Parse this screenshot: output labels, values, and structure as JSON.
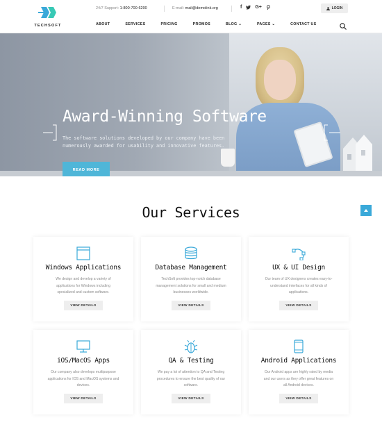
{
  "brand": {
    "name": "TECHSOFT",
    "accent": "#3aa9d9",
    "button_blue": "#4fb6d8"
  },
  "topbar": {
    "support_label": "24/7 Support:",
    "support_phone": "1-800-700-6200",
    "email_label": "E-mail:",
    "email": "mail@demolink.org",
    "socials": [
      "facebook-icon",
      "twitter-icon",
      "google-plus-icon",
      "pinterest-icon"
    ],
    "social_glyphs": [
      "f",
      "❦",
      "G+",
      "℗"
    ],
    "login_label": "LOGIN"
  },
  "nav": {
    "items": [
      {
        "label": "ABOUT"
      },
      {
        "label": "SERVICES"
      },
      {
        "label": "PRICING"
      },
      {
        "label": "PROMOS"
      },
      {
        "label": "BLOG ⌄"
      },
      {
        "label": "PAGES ⌄"
      },
      {
        "label": "CONTACT US"
      }
    ]
  },
  "hero": {
    "title": "Award-Winning Software",
    "subtitle": "The software solutions developed by our company have been numerously awarded for usability and innovative features.",
    "cta_label": "READ MORE"
  },
  "services": {
    "title": "Our Services",
    "button_label": "VIEW DETAILS",
    "items": [
      {
        "title": "Windows Applications",
        "icon": "window-icon",
        "desc": "We design and develop a variety of applications for Windows including specialized and custom software."
      },
      {
        "title": "Database Management",
        "icon": "database-icon",
        "desc": "TechSoft provides top-notch database management solutions for small and medium businesses worldwide."
      },
      {
        "title": "UX & UI Design",
        "icon": "vector-design-icon",
        "desc": "Our team of UX designers creates easy-to-understand interfaces for all kinds of applications."
      },
      {
        "title": "iOS/MacOS Apps",
        "icon": "monitor-icon",
        "desc": "Our company also develops multipurpose applications for IOS and MacOS systems and devices."
      },
      {
        "title": "QA & Testing",
        "icon": "bug-icon",
        "desc": "We pay a lot of attention to QA and Testing procedures to ensure the best quality of our software."
      },
      {
        "title": "Android Applications",
        "icon": "smartphone-icon",
        "desc": "Our Android apps are highly rated by media and our users as they offer great features on all Android devices."
      }
    ]
  }
}
